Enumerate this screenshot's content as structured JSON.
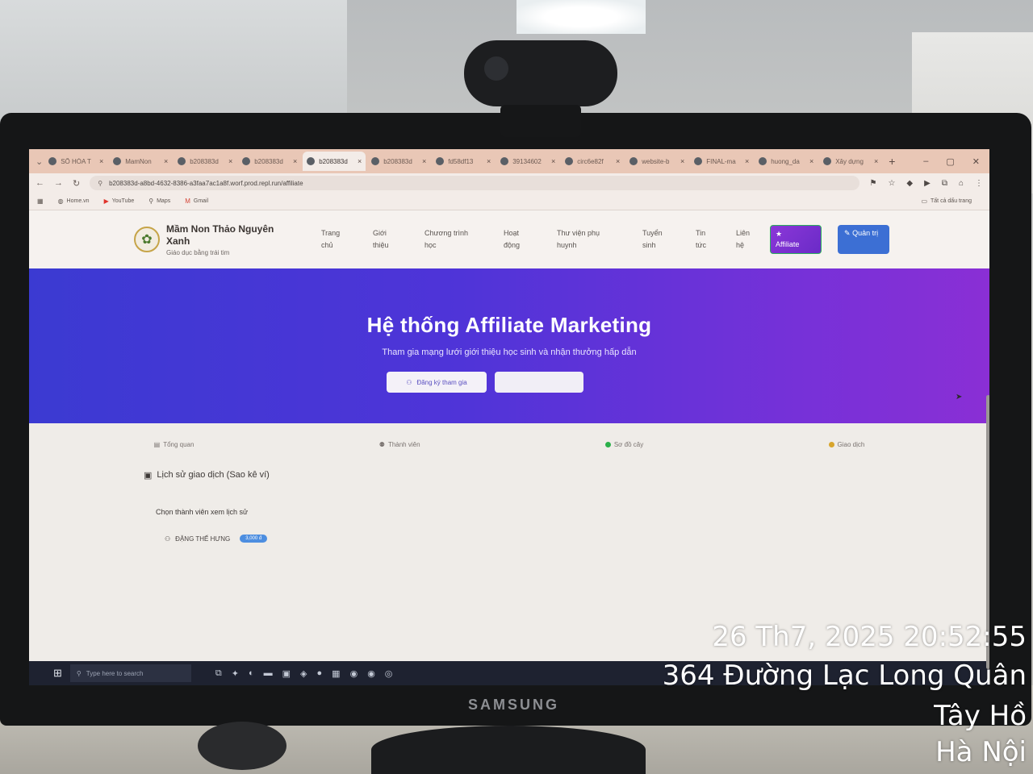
{
  "browser": {
    "tabs": [
      {
        "label": "SỐ HÓA T",
        "active": false
      },
      {
        "label": "MamNon",
        "active": false
      },
      {
        "label": "b208383d",
        "active": false
      },
      {
        "label": "b208383d",
        "active": false
      },
      {
        "label": "b208383d",
        "active": true
      },
      {
        "label": "b208383d",
        "active": false
      },
      {
        "label": "fd58df13",
        "active": false
      },
      {
        "label": "39134602",
        "active": false
      },
      {
        "label": "circ6e82f",
        "active": false
      },
      {
        "label": "website-b",
        "active": false
      },
      {
        "label": "FINAL-ma",
        "active": false
      },
      {
        "label": "huong_da",
        "active": false
      },
      {
        "label": "Xây dựng",
        "active": false
      }
    ],
    "url": "b208383d-a8bd-4632-8386-a3faa7ac1a8f.worf.prod.repl.run/affiliate",
    "bookmarks": [
      {
        "label": "Home.vn"
      },
      {
        "label": "YouTube"
      },
      {
        "label": "Maps"
      },
      {
        "label": "Gmail"
      }
    ],
    "all_bookmarks": "Tất cả dấu trang"
  },
  "site": {
    "brand_name": "Mầm Non Thảo Nguyên Xanh",
    "brand_tagline": "Giáo dục bằng trái tim",
    "menu": [
      "Trang chủ",
      "Giới thiệu",
      "Chương trình học",
      "Hoạt động",
      "Thư viện phụ huynh",
      "Tuyển sinh",
      "Tin tức",
      "Liên hệ"
    ],
    "affiliate_button": "Affiliate",
    "admin_button": "Quản trị"
  },
  "hero": {
    "title": "Hệ thống Affiliate Marketing",
    "subtitle": "Tham gia mạng lưới giới thiệu học sinh và nhận thưởng hấp dẫn",
    "register_button": "Đăng ký tham gia"
  },
  "content": {
    "tabs": [
      "Tổng quan",
      "Thành viên",
      "Sơ đồ cây",
      "Giao dịch"
    ],
    "section_title": "Lịch sử giao dịch (Sao kê ví)",
    "select_hint": "Chọn thành viên xem lịch sử",
    "member": {
      "name": "ĐẶNG THẾ HƯNG",
      "balance": "3,000 đ"
    }
  },
  "taskbar": {
    "search_placeholder": "Type here to search"
  },
  "monitor_brand": "SAMSUNG",
  "photo_stamp": {
    "datetime": "26 Th7, 2025 20:52:55",
    "address": "364 Đường Lạc Long Quân",
    "district": "Tây Hồ",
    "city": "Hà Nội"
  }
}
